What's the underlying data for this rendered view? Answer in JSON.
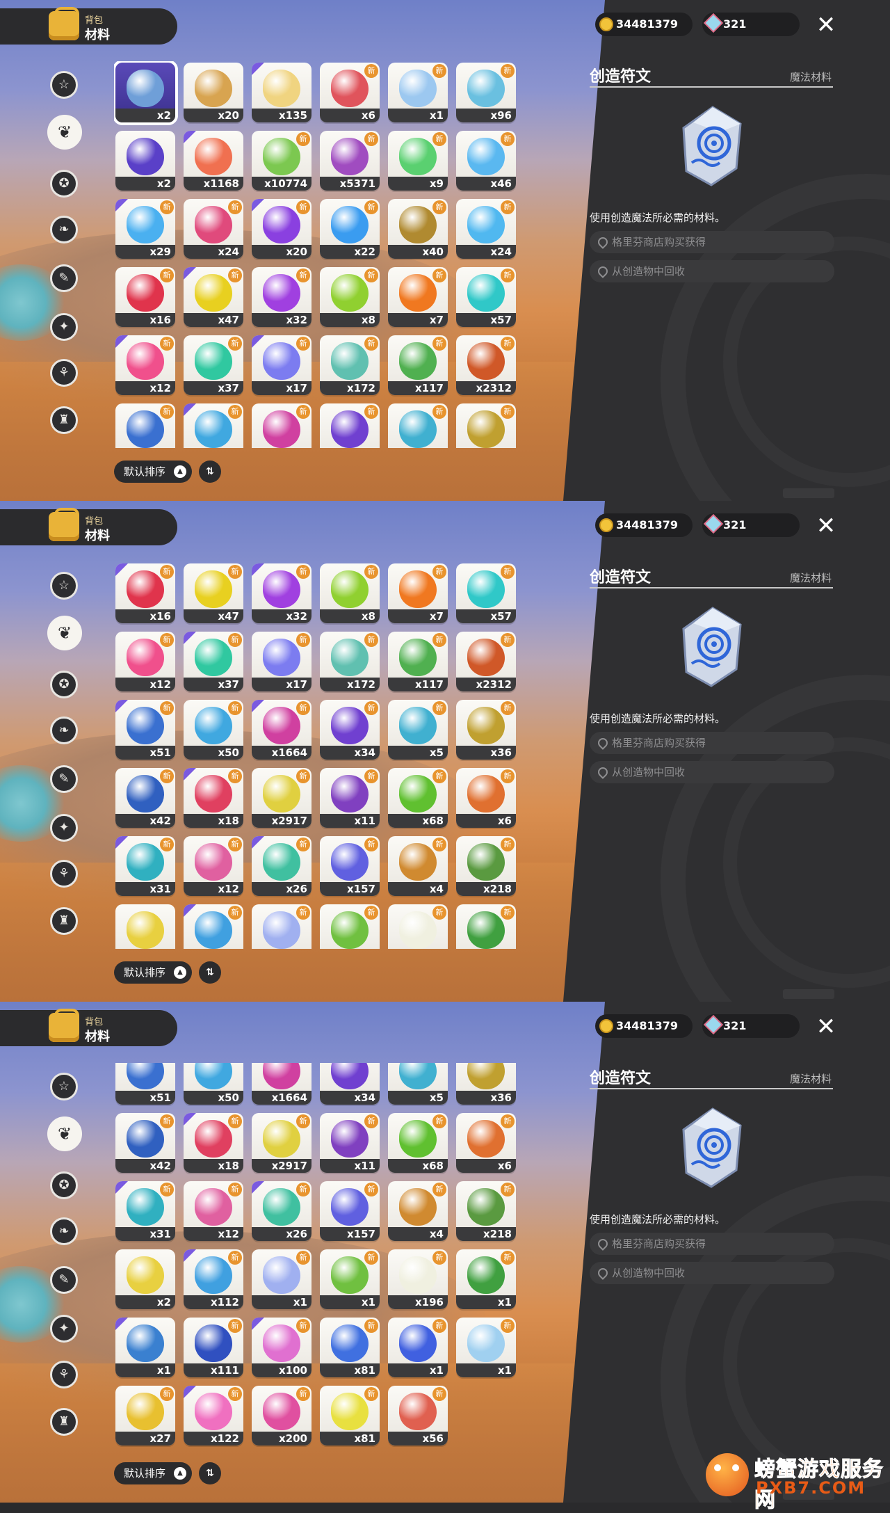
{
  "header": {
    "tab_small": "背包",
    "tab_big": "材料"
  },
  "currency": {
    "gold": "34481379",
    "gems": "321"
  },
  "detail": {
    "title": "创造符文",
    "category": "魔法材料",
    "description": "使用创造魔法所必需的材料。",
    "sources": [
      "格里芬商店购买获得",
      "从创造物中回收"
    ]
  },
  "sort": {
    "label": "默认排序",
    "order_symbol": "⇅"
  },
  "sidebar_icons": [
    "star-icon",
    "leaf-icon",
    "spiral-star-icon",
    "feather-icon",
    "spellbook-icon",
    "moon-star-icon",
    "acorn-icon",
    "armor-icon"
  ],
  "watermark": {
    "title": "螃蟹游戏服务网",
    "url": "PXB7.COM"
  },
  "panels": [
    {
      "rows": [
        [
          {
            "c": "x2",
            "col": "#6f9fd8",
            "sel": true
          },
          {
            "c": "x20",
            "col": "#d8a450"
          },
          {
            "c": "x135",
            "col": "#f0d480"
          },
          {
            "c": "x6",
            "col": "#e0545c",
            "n": true
          },
          {
            "c": "x1",
            "col": "#9cc8f0",
            "n": true
          },
          {
            "c": "x96",
            "col": "#6ac0e0",
            "n": true
          }
        ],
        [
          {
            "c": "x2",
            "col": "#5a40c8"
          },
          {
            "c": "x1168",
            "col": "#f07050"
          },
          {
            "c": "x10774",
            "col": "#7cc850",
            "n": true
          },
          {
            "c": "x5371",
            "col": "#a04cc0",
            "n": true
          },
          {
            "c": "x9",
            "col": "#5ad070",
            "n": true
          },
          {
            "c": "x46",
            "col": "#5ab8f0",
            "n": true
          }
        ],
        [
          {
            "c": "x29",
            "col": "#4ab0f0",
            "n": true
          },
          {
            "c": "x24",
            "col": "#e04a7c",
            "n": true
          },
          {
            "c": "x20",
            "col": "#8a40e0",
            "n": true
          },
          {
            "c": "x22",
            "col": "#3a9cf0",
            "n": true
          },
          {
            "c": "x40",
            "col": "#b08a30",
            "n": true
          },
          {
            "c": "x24",
            "col": "#50b8f0",
            "n": true
          }
        ],
        [
          {
            "c": "x16",
            "col": "#e0344c",
            "n": true
          },
          {
            "c": "x47",
            "col": "#e8d020",
            "n": true
          },
          {
            "c": "x32",
            "col": "#a040e0",
            "n": true
          },
          {
            "c": "x8",
            "col": "#90d030",
            "n": true
          },
          {
            "c": "x7",
            "col": "#f07820",
            "n": true
          },
          {
            "c": "x57",
            "col": "#30c8c8",
            "n": true
          }
        ],
        [
          {
            "c": "x12",
            "col": "#f0508c",
            "n": true
          },
          {
            "c": "x37",
            "col": "#30c8a0",
            "n": true
          },
          {
            "c": "x17",
            "col": "#7c7cf0",
            "n": true
          },
          {
            "c": "x172",
            "col": "#60c0b0",
            "n": true
          },
          {
            "c": "x117",
            "col": "#50b050",
            "n": true
          },
          {
            "c": "x2312",
            "col": "#d05828",
            "n": true
          }
        ],
        [
          {
            "c": "",
            "col": "#3a70d0",
            "n": true
          },
          {
            "c": "",
            "col": "#40a8e0",
            "n": true
          },
          {
            "c": "",
            "col": "#d040a0",
            "n": true
          },
          {
            "c": "",
            "col": "#7040d0",
            "n": true
          },
          {
            "c": "",
            "col": "#40b0d0",
            "n": true
          },
          {
            "c": "",
            "col": "#c0a030",
            "n": true
          }
        ]
      ]
    },
    {
      "rows": [
        [
          {
            "c": "x16",
            "col": "#e0344c",
            "n": true
          },
          {
            "c": "x47",
            "col": "#e8d020",
            "n": true
          },
          {
            "c": "x32",
            "col": "#a040e0",
            "n": true
          },
          {
            "c": "x8",
            "col": "#90d030",
            "n": true
          },
          {
            "c": "x7",
            "col": "#f07820",
            "n": true
          },
          {
            "c": "x57",
            "col": "#30c8c8",
            "n": true
          }
        ],
        [
          {
            "c": "x12",
            "col": "#f0508c",
            "n": true
          },
          {
            "c": "x37",
            "col": "#30c8a0",
            "n": true
          },
          {
            "c": "x17",
            "col": "#7c7cf0",
            "n": true
          },
          {
            "c": "x172",
            "col": "#60c0b0",
            "n": true
          },
          {
            "c": "x117",
            "col": "#50b050",
            "n": true
          },
          {
            "c": "x2312",
            "col": "#d05828",
            "n": true
          }
        ],
        [
          {
            "c": "x51",
            "col": "#3a70d0",
            "n": true
          },
          {
            "c": "x50",
            "col": "#40a8e0",
            "n": true
          },
          {
            "c": "x1664",
            "col": "#d040a0",
            "n": true
          },
          {
            "c": "x34",
            "col": "#7040d0",
            "n": true
          },
          {
            "c": "x5",
            "col": "#40b0d0",
            "n": true
          },
          {
            "c": "x36",
            "col": "#c0a030",
            "n": true
          }
        ],
        [
          {
            "c": "x42",
            "col": "#3060c0",
            "n": true
          },
          {
            "c": "x18",
            "col": "#e04060",
            "n": true
          },
          {
            "c": "x2917",
            "col": "#e0d040",
            "n": true
          },
          {
            "c": "x11",
            "col": "#8040c0",
            "n": true
          },
          {
            "c": "x68",
            "col": "#60c030",
            "n": true
          },
          {
            "c": "x6",
            "col": "#e07030",
            "n": true
          }
        ],
        [
          {
            "c": "x31",
            "col": "#30b0c0",
            "n": true
          },
          {
            "c": "x12",
            "col": "#e060a0",
            "n": true
          },
          {
            "c": "x26",
            "col": "#40c0a0",
            "n": true
          },
          {
            "c": "x157",
            "col": "#6060e0",
            "n": true
          },
          {
            "c": "x4",
            "col": "#d08a30",
            "n": true
          },
          {
            "c": "x218",
            "col": "#5a9a40",
            "n": true
          }
        ],
        [
          {
            "c": "",
            "col": "#e8d040"
          },
          {
            "c": "",
            "col": "#40a0e0",
            "n": true
          },
          {
            "c": "",
            "col": "#a0b0f0",
            "n": true
          },
          {
            "c": "",
            "col": "#70c040",
            "n": true
          },
          {
            "c": "",
            "col": "#f0f0e0",
            "n": true
          },
          {
            "c": "",
            "col": "#40a040",
            "n": true
          }
        ]
      ]
    },
    {
      "rows": [
        [
          {
            "c": "x51",
            "col": "#3a70d0"
          },
          {
            "c": "x50",
            "col": "#40a8e0"
          },
          {
            "c": "x1664",
            "col": "#d040a0"
          },
          {
            "c": "x34",
            "col": "#7040d0"
          },
          {
            "c": "x5",
            "col": "#40b0d0"
          },
          {
            "c": "x36",
            "col": "#c0a030"
          }
        ],
        [
          {
            "c": "x42",
            "col": "#3060c0",
            "n": true
          },
          {
            "c": "x18",
            "col": "#e04060",
            "n": true
          },
          {
            "c": "x2917",
            "col": "#e0d040",
            "n": true
          },
          {
            "c": "x11",
            "col": "#8040c0",
            "n": true
          },
          {
            "c": "x68",
            "col": "#60c030",
            "n": true
          },
          {
            "c": "x6",
            "col": "#e07030",
            "n": true
          }
        ],
        [
          {
            "c": "x31",
            "col": "#30b0c0",
            "n": true
          },
          {
            "c": "x12",
            "col": "#e060a0",
            "n": true
          },
          {
            "c": "x26",
            "col": "#40c0a0",
            "n": true
          },
          {
            "c": "x157",
            "col": "#6060e0",
            "n": true
          },
          {
            "c": "x4",
            "col": "#d08a30",
            "n": true
          },
          {
            "c": "x218",
            "col": "#5a9a40",
            "n": true
          }
        ],
        [
          {
            "c": "x2",
            "col": "#e8d040"
          },
          {
            "c": "x112",
            "col": "#40a0e0",
            "n": true
          },
          {
            "c": "x1",
            "col": "#a0b0f0",
            "n": true
          },
          {
            "c": "x1",
            "col": "#70c040",
            "n": true
          },
          {
            "c": "x196",
            "col": "#f0f0e0",
            "n": true
          },
          {
            "c": "x1",
            "col": "#40a040",
            "n": true
          }
        ],
        [
          {
            "c": "x1",
            "col": "#3a80d0"
          },
          {
            "c": "x111",
            "col": "#3050c0",
            "n": true
          },
          {
            "c": "x100",
            "col": "#e070d0",
            "n": true
          },
          {
            "c": "x81",
            "col": "#4070e0",
            "n": true
          },
          {
            "c": "x1",
            "col": "#4060e0",
            "n": true
          },
          {
            "c": "x1",
            "col": "#a0d0f0",
            "n": true
          }
        ],
        [
          {
            "c": "x27",
            "col": "#e8c030",
            "n": true
          },
          {
            "c": "x122",
            "col": "#f070c0",
            "n": true
          },
          {
            "c": "x200",
            "col": "#e050a0",
            "n": true
          },
          {
            "c": "x81",
            "col": "#e8e040",
            "n": true
          },
          {
            "c": "x56",
            "col": "#e06050",
            "n": true
          }
        ]
      ]
    }
  ]
}
